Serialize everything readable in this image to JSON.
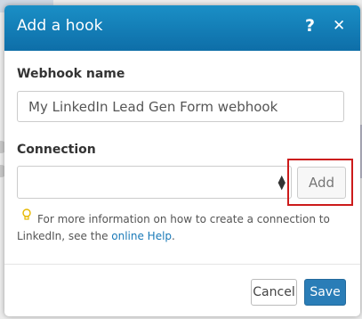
{
  "dialog": {
    "title": "Add a hook",
    "help_icon": "question-icon",
    "close_icon": "close-icon"
  },
  "webhook": {
    "label": "Webhook name",
    "value": "My LinkedIn Lead Gen Form webhook"
  },
  "connection": {
    "label": "Connection",
    "selected": "",
    "add_label": "Add"
  },
  "help": {
    "icon": "lightbulb-icon",
    "text_before": "For more information on how to create a connection to LinkedIn, see the ",
    "link_text": "online Help",
    "text_after": "."
  },
  "footer": {
    "cancel_label": "Cancel",
    "save_label": "Save"
  },
  "colors": {
    "header": "#1a8fc6",
    "highlight": "#cc1b1b",
    "primary": "#2a7db7"
  }
}
